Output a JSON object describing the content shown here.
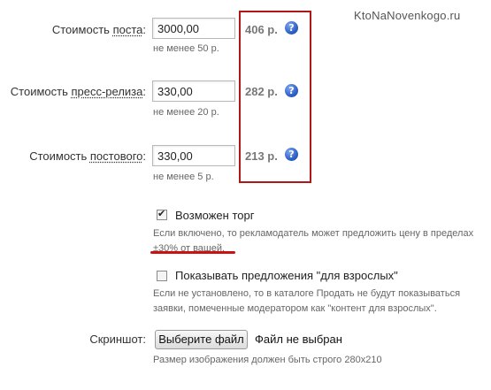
{
  "watermark": "KtoNaNovenkogo.ru",
  "post_cost": {
    "label_prefix": "Стоимость ",
    "label_link": "поста",
    "label_suffix": ":",
    "value": "3000,00",
    "hint": "не менее 50 р.",
    "price": "406 р."
  },
  "press_release_cost": {
    "label_prefix": "Стоимость ",
    "label_link": "пресс-релиза",
    "label_suffix": ":",
    "value": "330,00",
    "hint": "не менее 20 р.",
    "price": "282 р."
  },
  "permanent_cost": {
    "label_prefix": "Стоимость ",
    "label_link": "постового",
    "label_suffix": ":",
    "value": "330,00",
    "hint": "не менее 5 р.",
    "price": "213 р."
  },
  "help_glyph": "?",
  "bargain": {
    "label": "Возможен торг",
    "checked": true,
    "desc_line1": "Если включено, то рекламодатель может предложить цену в пределах",
    "desc_line2": "±30% от вашей."
  },
  "adult": {
    "label": "Показывать предложения \"для взрослых\"",
    "checked": false,
    "desc_line1": "Если не установлено, то в каталоге Продать не будут показываться",
    "desc_line2": "заявки, помеченные модератором как \"контент для взрослых\"."
  },
  "screenshot": {
    "label": "Скриншот:",
    "button": "Выберите файл",
    "status": "Файл не выбран",
    "hint": "Размер изображения должен быть строго 280x210"
  },
  "colors": {
    "highlight_box": "#b01818",
    "help_icon": "#2f61c7",
    "price_text": "#777777"
  }
}
